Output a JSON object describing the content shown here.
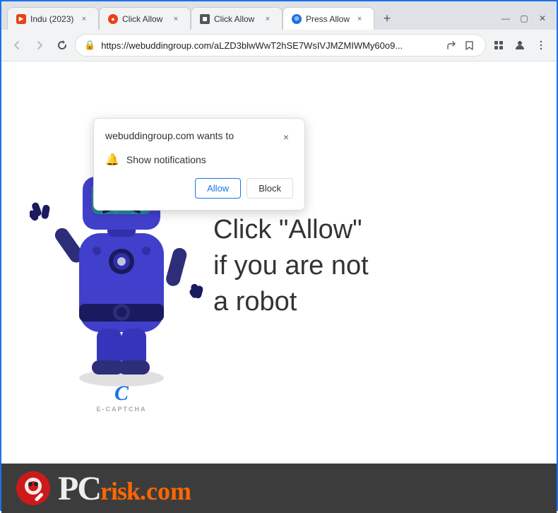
{
  "browser": {
    "tabs": [
      {
        "id": "tab1",
        "title": "Indu (2023)",
        "favicon": "indu",
        "active": false
      },
      {
        "id": "tab2",
        "title": "Click Allow",
        "favicon": "click1",
        "active": false
      },
      {
        "id": "tab3",
        "title": "Click Allow",
        "favicon": "click2",
        "active": false
      },
      {
        "id": "tab4",
        "title": "Press Allow",
        "favicon": "press",
        "active": true
      }
    ],
    "new_tab_label": "+",
    "url": "https://webuddingroup.com/aLZD3blwWwT2hSE7WsIVJMZMIWMy60o9...",
    "nav": {
      "back": "←",
      "forward": "→",
      "refresh": "↻"
    }
  },
  "popup": {
    "title": "webuddingroup.com wants to",
    "permission": "Show notifications",
    "allow_label": "Allow",
    "block_label": "Block",
    "close": "×"
  },
  "page": {
    "main_text": "Click \"Allow\"\nif you are not\na robot",
    "captcha_label": "E-CAPTCHA"
  },
  "brand": {
    "name": "PCrisk.com",
    "pc": "PC",
    "risk": "risk",
    "dot_com": ".com"
  }
}
